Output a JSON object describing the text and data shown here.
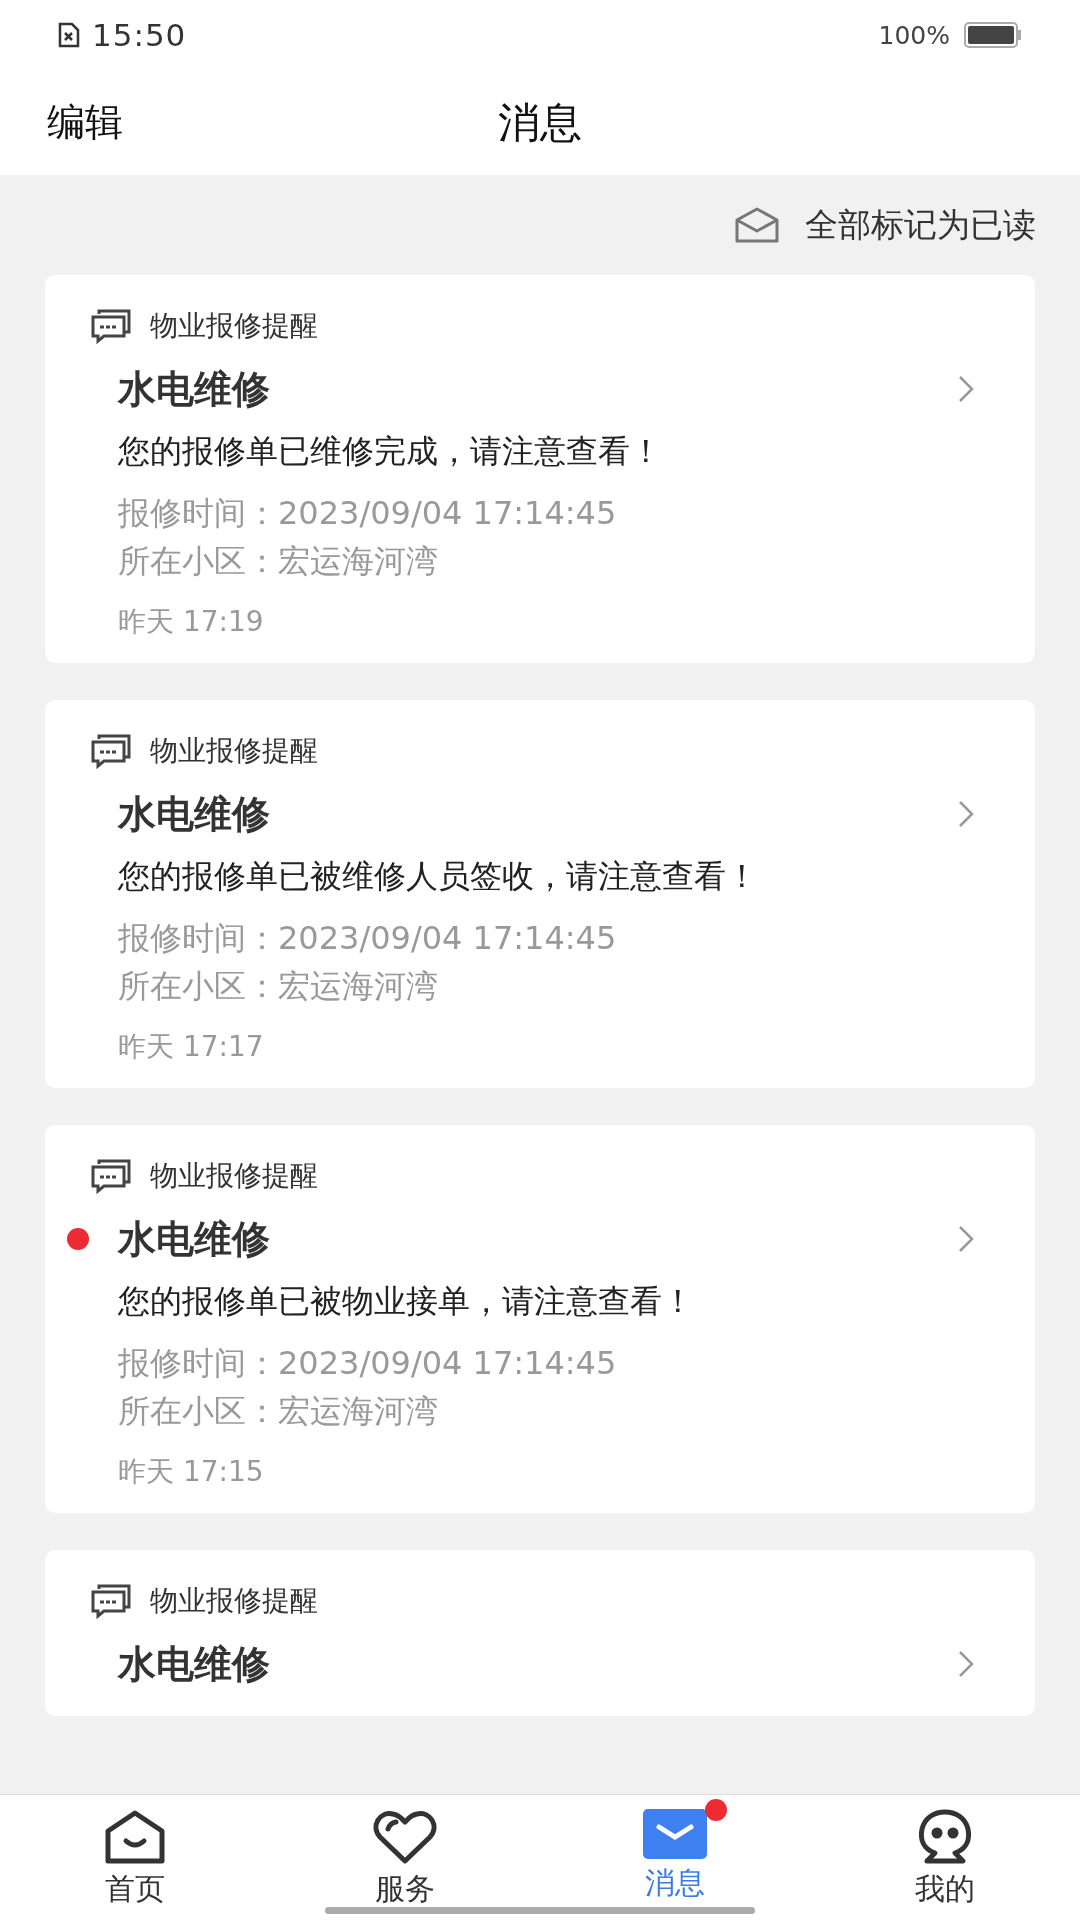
{
  "status_bar": {
    "time": "15:50",
    "battery": "100%"
  },
  "header": {
    "edit": "编辑",
    "title": "消息"
  },
  "mark_all_read": "全部标记为已读",
  "messages": [
    {
      "category": "物业报修提醒",
      "title": "水电维修",
      "unread": false,
      "body": "您的报修单已维修完成，请注意查看！",
      "details": [
        "报修时间：2023/09/04 17:14:45",
        "所在小区：宏运海河湾"
      ],
      "time": "昨天 17:19"
    },
    {
      "category": "物业报修提醒",
      "title": "水电维修",
      "unread": false,
      "body": "您的报修单已被维修人员签收，请注意查看！",
      "details": [
        "报修时间：2023/09/04 17:14:45",
        "所在小区：宏运海河湾"
      ],
      "time": "昨天 17:17"
    },
    {
      "category": "物业报修提醒",
      "title": "水电维修",
      "unread": true,
      "body": "您的报修单已被物业接单，请注意查看！",
      "details": [
        "报修时间：2023/09/04 17:14:45",
        "所在小区：宏运海河湾"
      ],
      "time": "昨天 17:15"
    },
    {
      "category": "物业报修提醒",
      "title": "水电维修",
      "unread": false
    }
  ],
  "tab_bar": [
    {
      "kind": "home",
      "label": "首页",
      "selected": false,
      "badge": false
    },
    {
      "kind": "service",
      "label": "服务",
      "selected": false,
      "badge": false
    },
    {
      "kind": "messages",
      "label": "消息",
      "selected": true,
      "badge": true
    },
    {
      "kind": "profile",
      "label": "我的",
      "selected": false,
      "badge": false
    }
  ]
}
